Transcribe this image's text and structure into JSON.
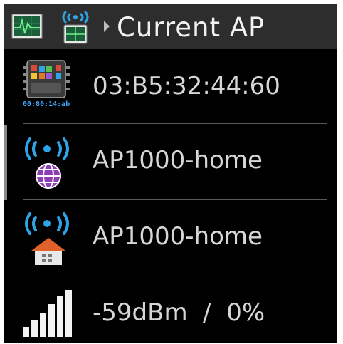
{
  "header": {
    "title": "Current AP",
    "icons": [
      "monitor-icon",
      "wireless-device-icon"
    ]
  },
  "rows": [
    {
      "icon": "mac-address-icon",
      "icon_caption": "00:80:14:ab",
      "label": "03:B5:32:44:60"
    },
    {
      "icon": "internet-ap-icon",
      "label": "AP1000-home"
    },
    {
      "icon": "home-ap-icon",
      "label": "AP1000-home"
    },
    {
      "icon": "signal-strength-icon",
      "label": "-59dBm  /  0%"
    }
  ],
  "colors": {
    "screen_bg": "#000000",
    "header_bg": "#2d2d2d",
    "text": "#d6d6d6",
    "wifi_blue": "#2ea3e6",
    "globe_purple": "#8b3fb3",
    "roof_orange": "#e0622a"
  }
}
